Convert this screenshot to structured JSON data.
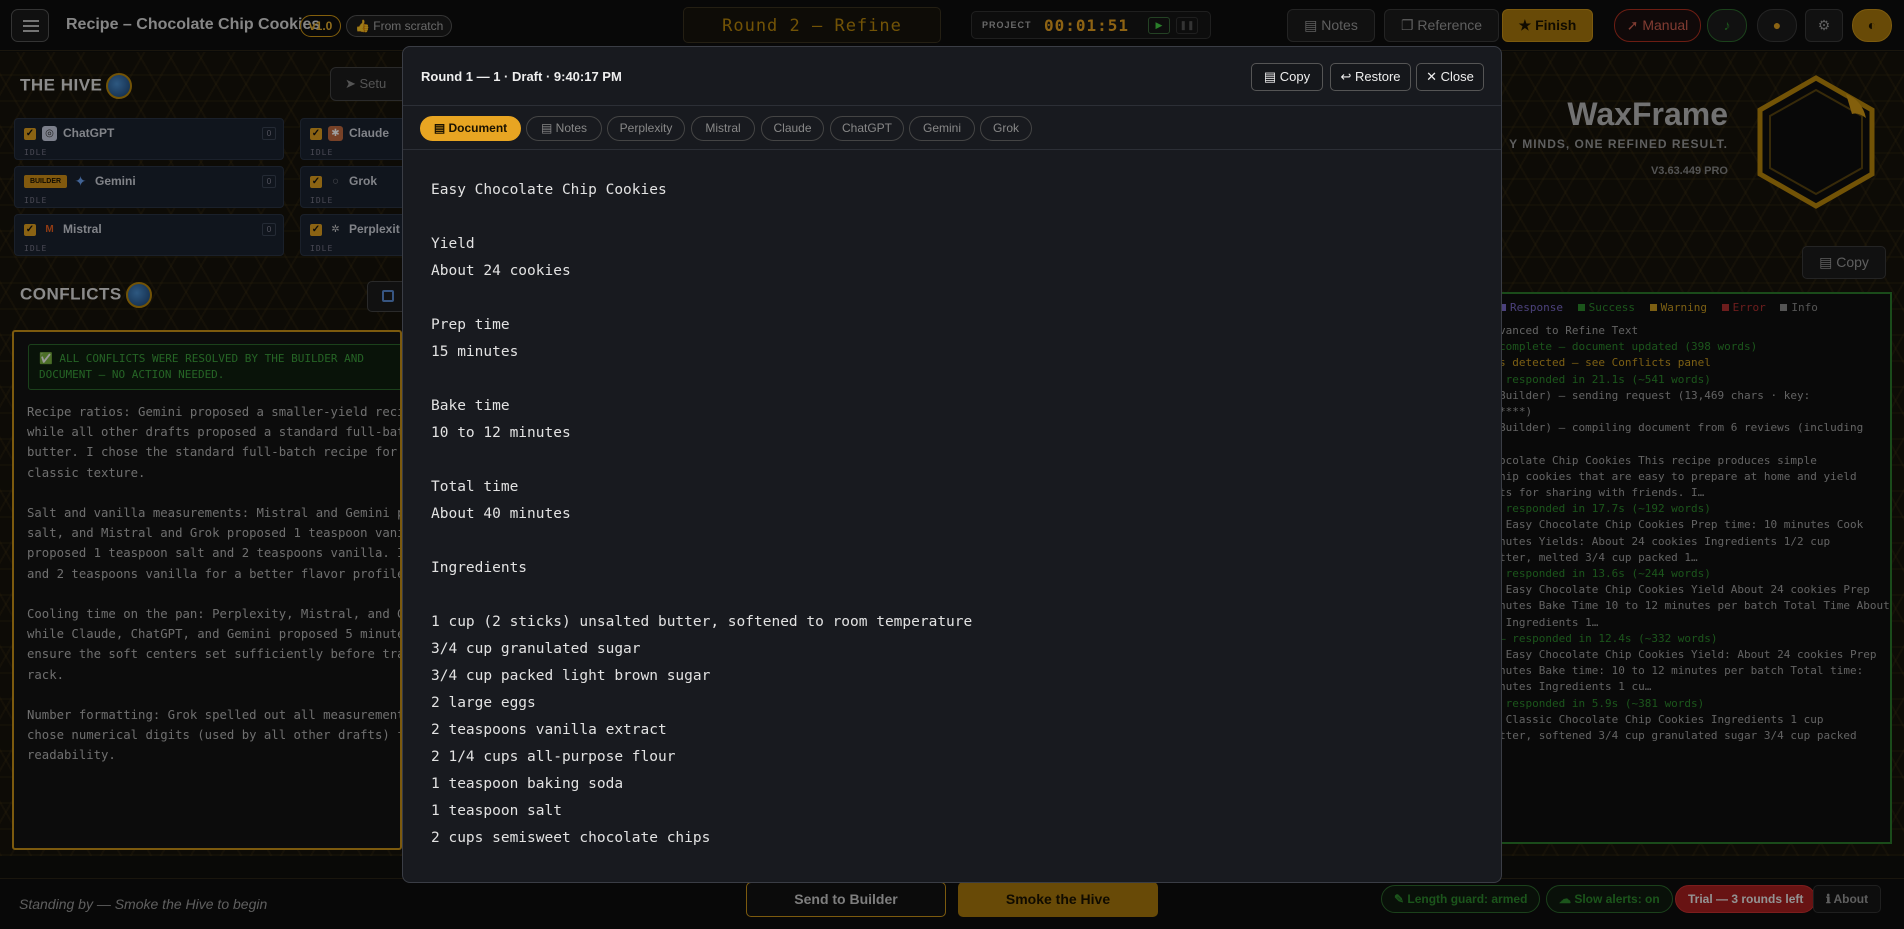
{
  "topbar": {
    "project_title": "Recipe – Chocolate Chip Cookies",
    "version": "v1.0",
    "origin": "From scratch",
    "round_label": "Round 2 — Refine",
    "project_label": "PROJECT",
    "timer": "00:01:51",
    "notes_label": "Notes",
    "reference_label": "Reference",
    "finish_label": "Finish",
    "manual_label": "Manual"
  },
  "hive": {
    "title": "THE HIVE",
    "setup_label": "Setu",
    "builder_badge": "BUILDER",
    "agents": [
      {
        "name": "ChatGPT",
        "status": "IDLE",
        "count": "0"
      },
      {
        "name": "Claude",
        "status": "IDLE",
        "count": ""
      },
      {
        "name": "Gemini",
        "status": "IDLE",
        "count": "0"
      },
      {
        "name": "Grok",
        "status": "IDLE",
        "count": ""
      },
      {
        "name": "Mistral",
        "status": "IDLE",
        "count": "0"
      },
      {
        "name": "Perplexit",
        "status": "IDLE",
        "count": ""
      }
    ]
  },
  "conflicts": {
    "title": "CONFLICTS",
    "banner_line1": "✅ ALL CONFLICTS WERE RESOLVED BY THE BUILDER AND",
    "banner_line2": "DOCUMENT — NO ACTION NEEDED.",
    "text": "Recipe ratios: Gemini proposed a smaller-yield recipe\nwhile all other drafts proposed a standard full-batch\nbutter. I chose the standard full-batch recipe for a\nclassic texture.\n\nSalt and vanilla measurements: Mistral and Gemini pr\nsalt, and Mistral and Grok proposed 1 teaspoon vanil\nproposed 1 teaspoon salt and 2 teaspoons vanilla. I\nand 2 teaspoons vanilla for a better flavor profile.\n\nCooling time on the pan: Perplexity, Mistral, and Gr\nwhile Claude, ChatGPT, and Gemini proposed 5 minutes\nensure the soft centers set sufficiently before tran\nrack.\n\nNumber formatting: Grok spelled out all measurement\nchose numerical digits (used by all other drafts) fo\nreadability."
  },
  "brand": {
    "name": "WaxFrame",
    "tagline": "Y MINDS, ONE REFINED RESULT.",
    "version": "V3.63.449 PRO",
    "copy_label": "Copy"
  },
  "log": {
    "legend": [
      "Response",
      "Success",
      "Warning",
      "Error",
      "Info"
    ],
    "legend_colors": [
      "#7a6ac8",
      "#2d8a2d",
      "#c89a20",
      "#b03030",
      "#888888"
    ],
    "lines": [
      {
        "text": "vanced to Refine Text",
        "c": ""
      },
      {
        "text": "complete — document updated (398 words)",
        "c": "g"
      },
      {
        "text": "s detected — see Conflicts panel",
        "c": "y"
      },
      {
        "text": " responded in 21.1s (~541 words)",
        "c": "g"
      },
      {
        "text": "Builder) — sending request (13,469 chars · key:",
        "c": ""
      },
      {
        "text": "****)",
        "c": ""
      },
      {
        "text": "Builder) — compiling document from 6 reviews (including",
        "c": ""
      },
      {
        "text": "",
        "c": ""
      },
      {
        "text": "ocolate Chip Cookies This recipe produces simple",
        "c": ""
      },
      {
        "text": "hip cookies that are easy to prepare at home and yield",
        "c": ""
      },
      {
        "text": "ts for sharing with friends. I…",
        "c": ""
      },
      {
        "text": " responded in 17.7s (~192 words)",
        "c": "g"
      },
      {
        "text": " Easy Chocolate Chip Cookies Prep time: 10 minutes Cook",
        "c": ""
      },
      {
        "text": "nutes Yields: About 24 cookies Ingredients 1/2 cup",
        "c": ""
      },
      {
        "text": "tter, melted 3/4 cup packed 1…",
        "c": ""
      },
      {
        "text": " responded in 13.6s (~244 words)",
        "c": "g"
      },
      {
        "text": " Easy Chocolate Chip Cookies Yield About 24 cookies Prep",
        "c": ""
      },
      {
        "text": "nutes Bake Time 10 to 12 minutes per batch Total Time About",
        "c": ""
      },
      {
        "text": " Ingredients 1…",
        "c": ""
      },
      {
        "text": "— responded in 12.4s (~332 words)",
        "c": "g"
      },
      {
        "text": " Easy Chocolate Chip Cookies Yield: About 24 cookies Prep",
        "c": ""
      },
      {
        "text": "nutes Bake time: 10 to 12 minutes per batch Total time:",
        "c": ""
      },
      {
        "text": "nutes Ingredients 1 cu…",
        "c": ""
      },
      {
        "text": " responded in 5.9s (~381 words)",
        "c": "g"
      },
      {
        "text": " Classic Chocolate Chip Cookies Ingredients 1 cup",
        "c": ""
      },
      {
        "text": "tter, softened 3/4 cup granulated sugar 3/4 cup packed",
        "c": ""
      }
    ]
  },
  "bottombar": {
    "standby": "Standing by — Smoke the Hive to begin",
    "send_label": "Send to Builder",
    "smoke_label": "Smoke the Hive",
    "length_guard": "Length guard: armed",
    "slow_alerts": "Slow alerts: on",
    "trial": "Trial — 3 rounds left",
    "about": "About"
  },
  "modal": {
    "title": "Round 1 — 1 · Draft · 9:40:17 PM",
    "copy_label": "Copy",
    "restore_label": "Restore",
    "close_label": "Close",
    "tabs": [
      "Document",
      "Notes",
      "Perplexity",
      "Mistral",
      "Claude",
      "ChatGPT",
      "Gemini",
      "Grok"
    ],
    "doc_lines": [
      "Easy Chocolate Chip Cookies",
      "",
      "Yield",
      "About 24 cookies",
      "",
      "Prep time",
      "15 minutes",
      "",
      "Bake time",
      "10 to 12 minutes",
      "",
      "Total time",
      "About 40 minutes",
      "",
      "Ingredients",
      "",
      "1 cup (2 sticks) unsalted butter, softened to room temperature",
      "3/4 cup granulated sugar",
      "3/4 cup packed light brown sugar",
      "2 large eggs",
      "2 teaspoons vanilla extract",
      "2 1/4 cups all-purpose flour",
      "1 teaspoon baking soda",
      "1 teaspoon salt",
      "2 cups semisweet chocolate chips"
    ]
  },
  "colors": {
    "accent": "#e8a522",
    "success": "#2d8a2d",
    "danger": "#a82020"
  }
}
